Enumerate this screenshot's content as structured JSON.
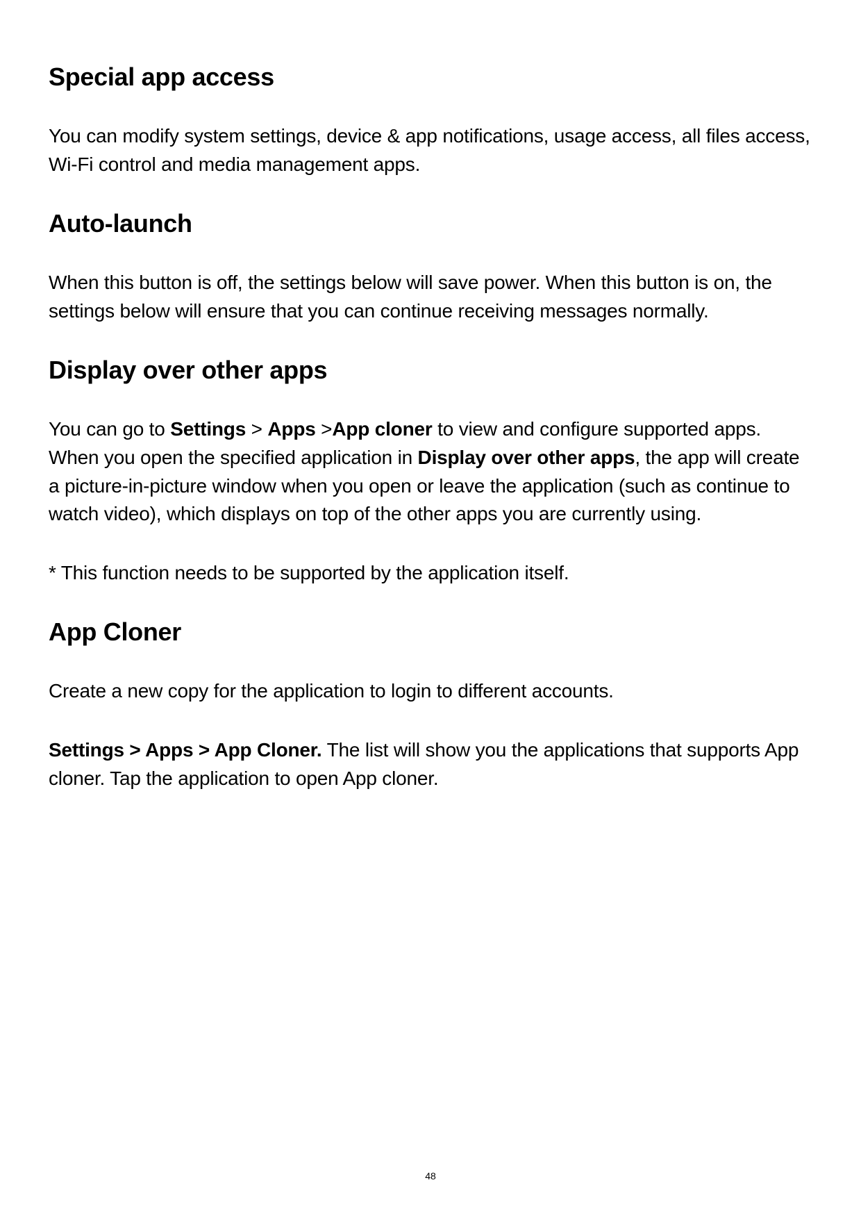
{
  "sections": {
    "special_app_access": {
      "heading": "Special app access",
      "body": "You can modify system settings, device & app notifications, usage access, all files access, Wi-Fi control and media management apps."
    },
    "auto_launch": {
      "heading": "Auto-launch",
      "body": "When this button is off, the settings below will save power. When this button is on, the settings below will ensure that you can continue receiving messages normally."
    },
    "display_over_other_apps": {
      "heading": "Display over other apps",
      "body_pre": "You can go to ",
      "bold_settings": "Settings",
      "sep1": " > ",
      "bold_apps": "Apps",
      "sep2": " >",
      "bold_app_cloner": "App cloner",
      "body_mid": " to view and configure supported apps. When you open the specified application in ",
      "bold_display": "Display over other apps",
      "body_post": ", the app will create a picture-in-picture window when you open or leave the application (such as continue to watch video), which displays on top of the other apps you are currently using.",
      "note": "* This function needs to be supported by the application itself."
    },
    "app_cloner": {
      "heading": "App Cloner",
      "body1": "Create a new copy for the application to login to different accounts.",
      "bold_path": "Settings > Apps > App Cloner.",
      "body2": " The list will show you the applications that supports App cloner. Tap the application to open App cloner."
    }
  },
  "page_number": "48"
}
